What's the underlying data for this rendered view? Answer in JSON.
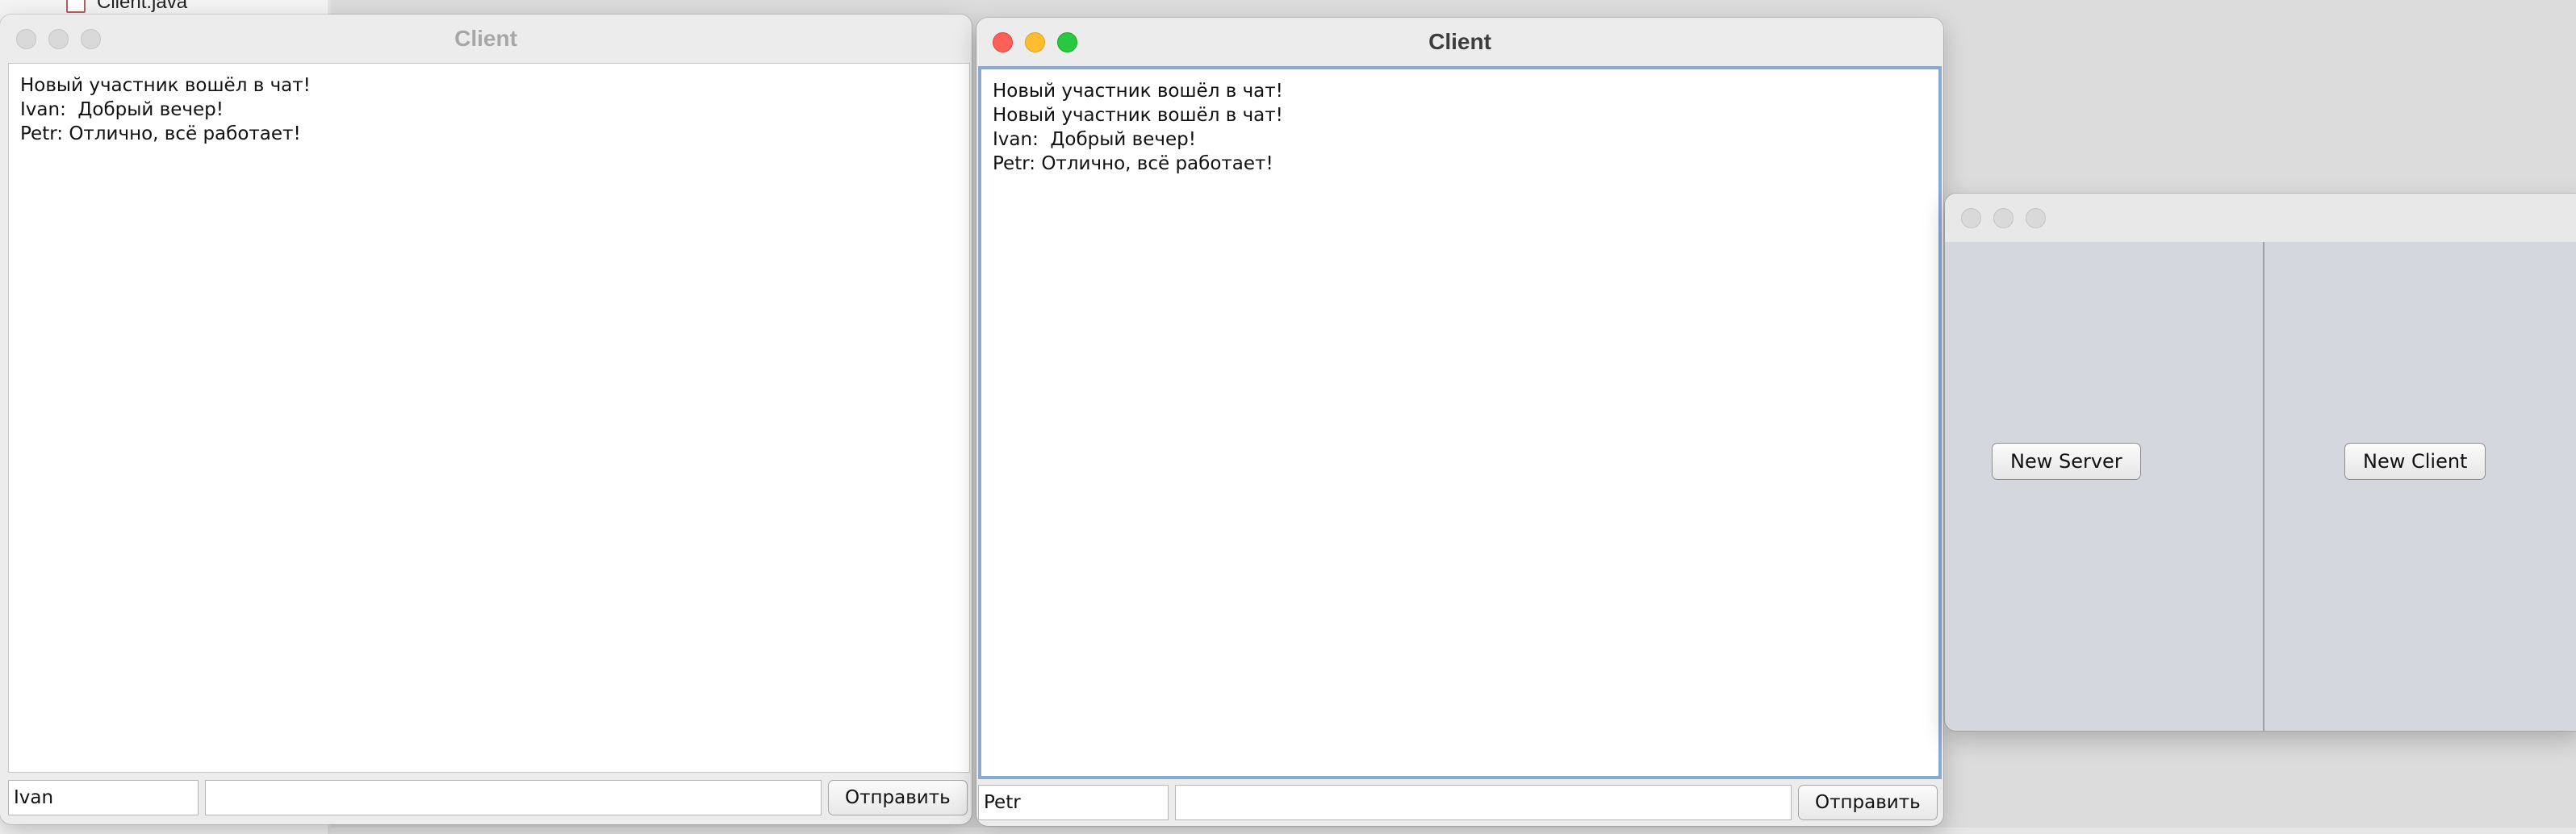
{
  "background": {
    "file_name": "Client.java"
  },
  "windows": {
    "client_ivan": {
      "title": "Client",
      "state": "inactive",
      "messages": [
        "Новый участник вошёл в чат!",
        "Ivan:  Добрый вечер!",
        "Petr: Отлично, всё работает!"
      ],
      "name_value": "Ivan",
      "message_value": "",
      "send_label": "Отправить"
    },
    "client_petr": {
      "title": "Client",
      "state": "active",
      "messages": [
        "Новый участник вошёл в чат!",
        "Новый участник вошёл в чат!",
        "Ivan:  Добрый вечер!",
        "Petr: Отлично, всё работает!"
      ],
      "name_value": "Petr",
      "message_value": "",
      "send_label": "Отправить"
    },
    "launcher": {
      "title": "",
      "state": "inactive",
      "new_server_label": "New Server",
      "new_client_label": "New Client"
    }
  },
  "colors": {
    "close": "#fe5f57",
    "minimize": "#febc2e",
    "zoom": "#28c840",
    "focus_ring": "#8aa9d3",
    "launcher_panel": "#d4d7de"
  },
  "icons": [
    "close-icon",
    "minimize-icon",
    "zoom-icon",
    "java-file-icon"
  ]
}
